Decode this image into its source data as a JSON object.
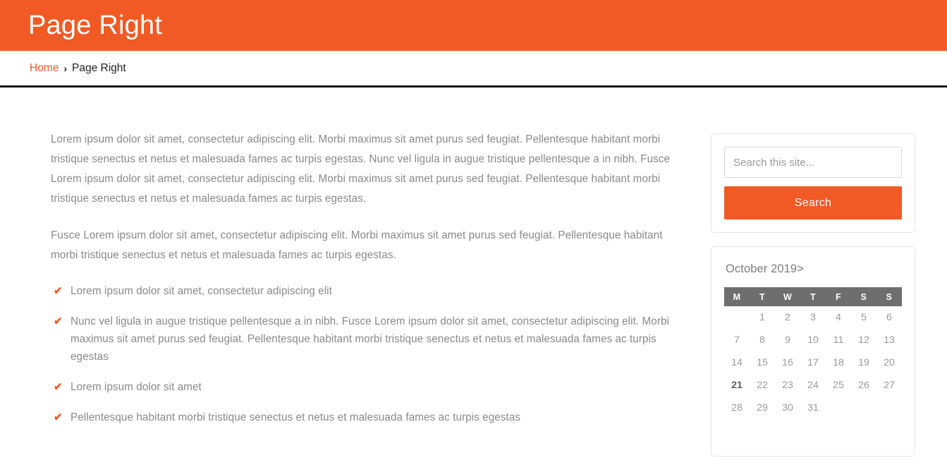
{
  "header": {
    "title": "Page Right",
    "background_color": "#f15a24"
  },
  "breadcrumb": {
    "home_label": "Home",
    "separator": "›",
    "current_label": "Page Right"
  },
  "main": {
    "paragraphs": [
      "Lorem ipsum dolor sit amet, consectetur adipiscing elit. Morbi maximus sit amet purus sed feugiat. Pellentesque habitant morbi tristique senectus et netus et malesuada fames ac turpis egestas. Nunc vel ligula in augue tristique pellentesque a in nibh. Fusce Lorem ipsum dolor sit amet, consectetur adipiscing elit. Morbi maximus sit amet purus sed feugiat. Pellentesque habitant morbi tristique senectus et netus et malesuada fames ac turpis egestas.",
      "Fusce Lorem ipsum dolor sit amet, consectetur adipiscing elit. Morbi maximus sit amet purus sed feugiat. Pellentesque habitant morbi tristique senectus et netus et malesuada fames ac turpis egestas."
    ],
    "list_marker": "✔",
    "list_items": [
      "Lorem ipsum dolor sit amet, consectetur adipiscing elit",
      "Nunc vel ligula in augue tristique pellentesque a in nibh. Fusce Lorem ipsum dolor sit amet, consectetur adipiscing elit. Morbi maximus sit amet purus sed feugiat. Pellentesque habitant morbi tristique senectus et netus et malesuada fames ac turpis egestas",
      "Lorem ipsum dolor sit amet",
      "Pellentesque habitant morbi tristique senectus et netus et malesuada fames ac turpis egestas"
    ]
  },
  "sidebar": {
    "search": {
      "placeholder": "Search this site...",
      "value": "",
      "button_label": "Search",
      "button_color": "#f15a24"
    },
    "calendar": {
      "caption": "October 2019",
      "next_label": ">",
      "day_headers": [
        "M",
        "T",
        "W",
        "T",
        "F",
        "S",
        "S"
      ],
      "weeks": [
        [
          "",
          "1",
          "2",
          "3",
          "4",
          "5",
          "6"
        ],
        [
          "7",
          "8",
          "9",
          "10",
          "11",
          "12",
          "13"
        ],
        [
          "14",
          "15",
          "16",
          "17",
          "18",
          "19",
          "20"
        ],
        [
          "21",
          "22",
          "23",
          "24",
          "25",
          "26",
          "27"
        ],
        [
          "28",
          "29",
          "30",
          "31",
          "",
          "",
          ""
        ]
      ],
      "today": "21",
      "header_bg_color": "#6e6e6e"
    }
  }
}
